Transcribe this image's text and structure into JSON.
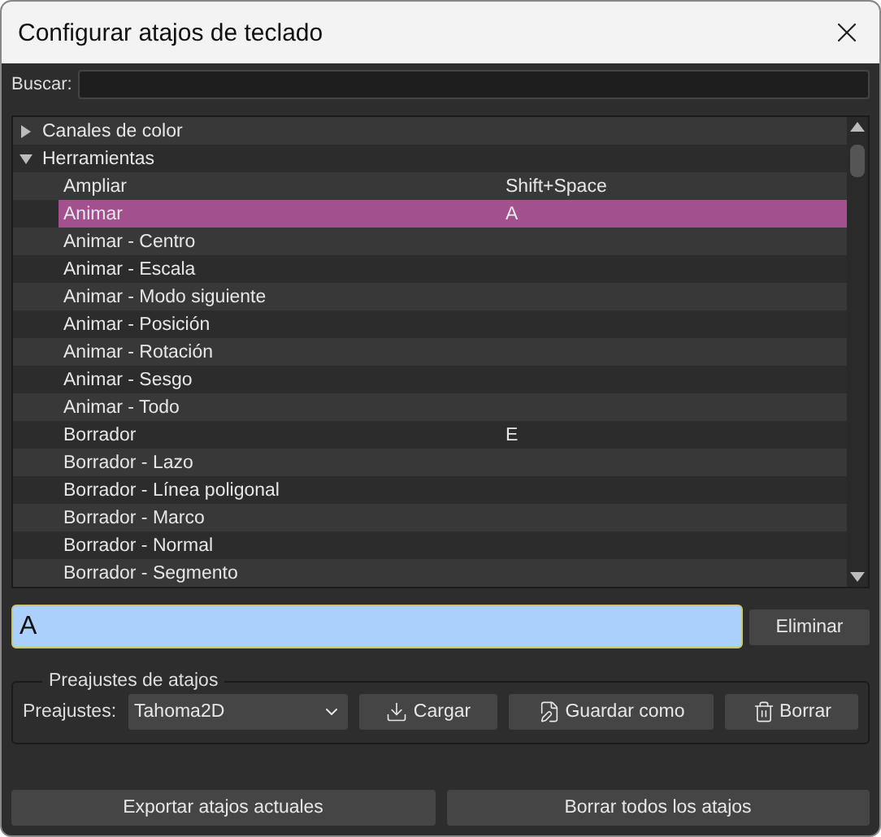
{
  "window": {
    "title": "Configurar atajos de teclado"
  },
  "search": {
    "label": "Buscar:"
  },
  "tree": [
    {
      "label": "Canales de color",
      "expanded": false
    },
    {
      "label": "Herramientas",
      "expanded": true,
      "children": [
        {
          "label": "Ampliar",
          "shortcut": "Shift+Space",
          "selected": false
        },
        {
          "label": "Animar",
          "shortcut": "A",
          "selected": true
        },
        {
          "label": "Animar - Centro",
          "selected": false
        },
        {
          "label": "Animar - Escala",
          "selected": false
        },
        {
          "label": "Animar - Modo siguiente",
          "selected": false
        },
        {
          "label": "Animar - Posición",
          "selected": false
        },
        {
          "label": "Animar - Rotación",
          "selected": false
        },
        {
          "label": "Animar - Sesgo",
          "selected": false
        },
        {
          "label": "Animar - Todo",
          "selected": false
        },
        {
          "label": "Borrador",
          "shortcut": "E",
          "selected": false
        },
        {
          "label": "Borrador - Lazo",
          "selected": false
        },
        {
          "label": "Borrador - Línea poligonal",
          "selected": false
        },
        {
          "label": "Borrador - Marco",
          "selected": false
        },
        {
          "label": "Borrador - Normal",
          "selected": false
        },
        {
          "label": "Borrador - Segmento",
          "selected": false
        }
      ]
    }
  ],
  "shortcut_field": {
    "value": "A",
    "remove_button": "Eliminar"
  },
  "presets": {
    "title": "Preajustes de atajos",
    "label": "Preajustes:",
    "value": "Tahoma2D",
    "buttons": [
      {
        "kind": "load",
        "label": "Cargar"
      },
      {
        "kind": "save",
        "label": "Guardar como"
      },
      {
        "kind": "delete",
        "label": "Borrar"
      }
    ]
  },
  "footer_buttons": [
    "Exportar atajos actuales",
    "Borrar todos los atajos"
  ]
}
